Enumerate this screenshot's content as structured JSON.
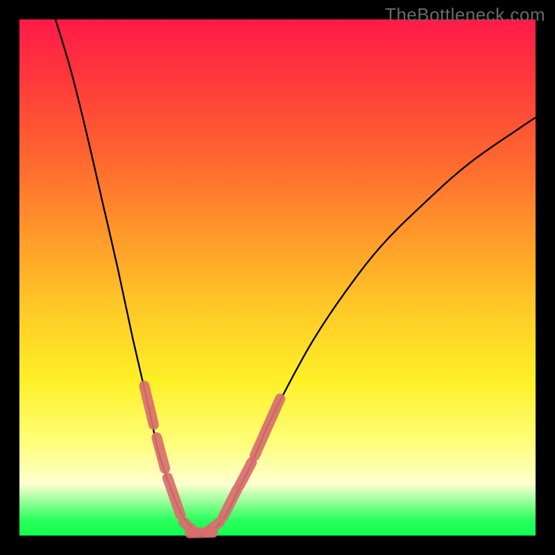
{
  "watermark": "TheBottleneck.com",
  "chart_data": {
    "type": "line",
    "title": "",
    "xlabel": "",
    "ylabel": "",
    "xlim": [
      0,
      100
    ],
    "ylim": [
      0,
      100
    ],
    "grid": false,
    "legend": false,
    "series": [
      {
        "name": "bottleneck-curve",
        "stroke": "#000000",
        "x": [
          7,
          10,
          13,
          16,
          19,
          22,
          25,
          27,
          29,
          31,
          32.5,
          34,
          35,
          36,
          38,
          40,
          42,
          45,
          48,
          52,
          57,
          63,
          70,
          78,
          87,
          97,
          100
        ],
        "y": [
          100,
          90,
          78,
          65,
          52,
          38,
          25,
          16,
          10,
          5,
          2.5,
          1.0,
          0.5,
          0.5,
          1.5,
          4,
          8,
          14,
          21,
          29,
          38,
          47,
          56,
          64,
          72,
          79,
          81
        ]
      },
      {
        "name": "marker-band-left",
        "stroke": "#d96e6e",
        "segments": [
          {
            "x": [
              24.2,
              26.0
            ],
            "y": [
              29.0,
              21.5
            ]
          },
          {
            "x": [
              26.6,
              28.2
            ],
            "y": [
              19.0,
              13.0
            ]
          },
          {
            "x": [
              28.7,
              31.2
            ],
            "y": [
              11.2,
              4.0
            ]
          },
          {
            "x": [
              31.8,
              34.0
            ],
            "y": [
              2.6,
              0.7
            ]
          }
        ]
      },
      {
        "name": "marker-band-right",
        "stroke": "#d96e6e",
        "segments": [
          {
            "x": [
              36.3,
              38.8
            ],
            "y": [
              0.7,
              2.6
            ]
          },
          {
            "x": [
              39.5,
              42.2
            ],
            "y": [
              3.7,
              9.0
            ]
          },
          {
            "x": [
              42.7,
              45.0
            ],
            "y": [
              9.8,
              14.2
            ]
          },
          {
            "x": [
              45.6,
              50.5
            ],
            "y": [
              15.5,
              26.5
            ]
          }
        ]
      },
      {
        "name": "marker-band-bottom",
        "stroke": "#d96e6e",
        "segments": [
          {
            "x": [
              33.0,
              37.5
            ],
            "y": [
              0.5,
              0.6
            ]
          }
        ]
      }
    ]
  }
}
